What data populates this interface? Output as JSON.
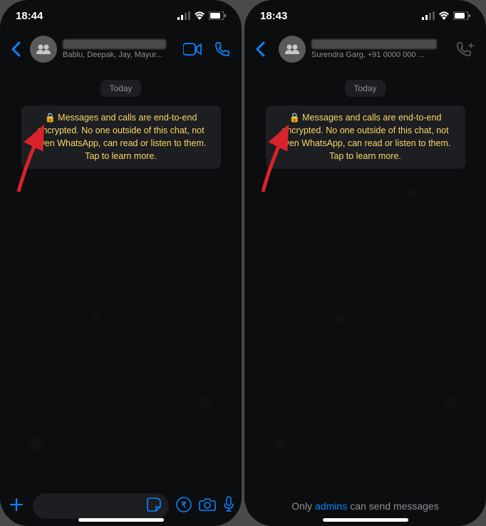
{
  "left": {
    "status": {
      "time": "18:44"
    },
    "header": {
      "subtitle": "Bablu, Deepak, Jay, Mayur..."
    },
    "chat": {
      "date_label": "Today",
      "encryption_text": "Messages and calls are end-to-end encrypted. No one outside of this chat, not even WhatsApp, can read or listen to them. Tap to learn more."
    }
  },
  "right": {
    "status": {
      "time": "18:43"
    },
    "header": {
      "subtitle": "Surendra Garg, +91 0000 000 ..."
    },
    "chat": {
      "date_label": "Today",
      "encryption_text": "Messages and calls are end-to-end encrypted. No one outside of this chat, not even WhatsApp, can read or listen to them. Tap to learn more."
    },
    "readonly": {
      "prefix": "Only",
      "link": "admins",
      "suffix": "can send messages"
    }
  }
}
